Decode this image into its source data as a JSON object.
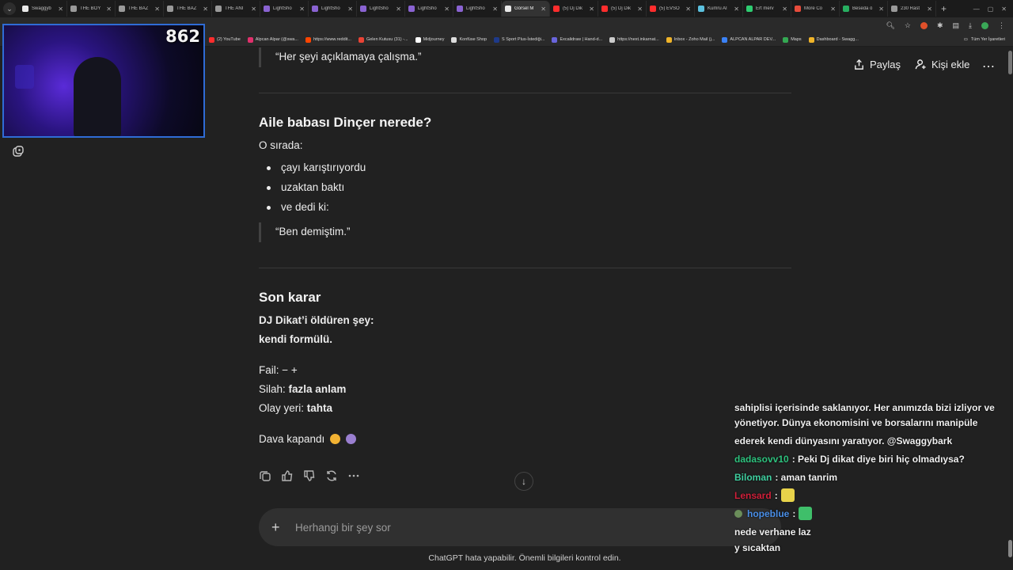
{
  "browser": {
    "tabs": [
      {
        "title": "Swaggyb",
        "color": "#e9e9e9",
        "active": false
      },
      {
        "title": "THE BOY",
        "color": "#9a9a9a",
        "active": false
      },
      {
        "title": "THE BAZ",
        "color": "#9a9a9a",
        "active": false
      },
      {
        "title": "THE BAZ",
        "color": "#9a9a9a",
        "active": false
      },
      {
        "title": "THE ANI",
        "color": "#9a9a9a",
        "active": false
      },
      {
        "title": "LightSho",
        "color": "#8a63d2",
        "active": false
      },
      {
        "title": "LightSho",
        "color": "#8a63d2",
        "active": false
      },
      {
        "title": "LightSho",
        "color": "#8a63d2",
        "active": false
      },
      {
        "title": "LightSho",
        "color": "#8a63d2",
        "active": false
      },
      {
        "title": "LightSho",
        "color": "#8a63d2",
        "active": false
      },
      {
        "title": "Görsel M",
        "color": "#e9e9e9",
        "active": true
      },
      {
        "title": "(5) Dj Dik",
        "color": "#ff2d2d",
        "active": false
      },
      {
        "title": "(5) Dj Dik",
        "color": "#ff2d2d",
        "active": false
      },
      {
        "title": "(5) EVSO",
        "color": "#ff2d2d",
        "active": false
      },
      {
        "title": "Kumru AI",
        "color": "#5bc0de",
        "active": false
      },
      {
        "title": "Ert merv",
        "color": "#2ecc71",
        "active": false
      },
      {
        "title": "More Co",
        "color": "#e74c3c",
        "active": false
      },
      {
        "title": "Beseda ö",
        "color": "#27ae60",
        "active": false
      },
      {
        "title": "230 Rast",
        "color": "#9a9a9a",
        "active": false
      }
    ],
    "bookmarks": [
      {
        "label": "(2) YouTube",
        "color": "#ff2d2d"
      },
      {
        "label": "Alpcan Alpar (@swa...",
        "color": "#e1306c"
      },
      {
        "label": "https://www.reddit...",
        "color": "#ff4500"
      },
      {
        "label": "Gelen Kutusu (31) -...",
        "color": "#ea4335"
      },
      {
        "label": "Midjourney",
        "color": "#ffffff"
      },
      {
        "label": "Konfüse Shop",
        "color": "#dddddd"
      },
      {
        "label": "S Sport Plus-İstediği...",
        "color": "#1e3a8a"
      },
      {
        "label": "Excalidraw | Hand-d...",
        "color": "#6965db"
      },
      {
        "label": "https://next.inkarnat...",
        "color": "#cccccc"
      },
      {
        "label": "Inbox - Zoho Mail (j...",
        "color": "#f0b429"
      },
      {
        "label": "ALPCAN ALPAR DEV...",
        "color": "#3b82f6"
      },
      {
        "label": "Maps",
        "color": "#34a853"
      },
      {
        "label": "Dashboard - Swagg...",
        "color": "#f0b429"
      }
    ],
    "all_bookmarks_label": "Tüm Yer İşaretleri"
  },
  "webcam": {
    "viewer_count": "862"
  },
  "header": {
    "share_label": "Paylaş",
    "add_person_label": "Kişi ekle",
    "more_label": "⋯"
  },
  "content": {
    "top_quote": "“Her şeyi açıklamaya çalışma.”",
    "section1": {
      "heading": "Aile babası Dinçer nerede?",
      "intro": "O sırada:",
      "bullets": [
        "çayı karıştırıyordu",
        "uzaktan baktı",
        "ve dedi ki:"
      ],
      "quote": "“Ben demiştim.”"
    },
    "section2": {
      "heading": "Son karar",
      "bold_line1": "DJ Dikat’i öldüren şey:",
      "bold_line2": "kendi formülü.",
      "fail_label": "Fail:",
      "fail_value": "− +",
      "weapon_label": "Silah:",
      "weapon_value": "fazla anlam",
      "scene_label": "Olay yeri:",
      "scene_value": "tahta",
      "closing": "Dava kapandı"
    }
  },
  "composer": {
    "placeholder": "Herhangi bir şey sor",
    "disclaimer": "ChatGPT hata yapabilir. Önemli bilgileri kontrol edin."
  },
  "stream_chat": {
    "cut_line": "sahiplisi içerisinde saklanıyor. Her anımızda bizi izliyor ve",
    "line2": "yönetiyor. Dünya ekonomisini ve borsalarını manipüle",
    "line3": "ederek kendi dünyasını yaratıyor. @Swaggybark",
    "messages": [
      {
        "user": "dadasovv10",
        "user_color": "#2ec27e",
        "text": ": Peki Dj dikat diye biri hiç olmadıysa?"
      },
      {
        "user": "Biloman",
        "user_color": "#3fd0a0",
        "text": ": aman tanrim"
      },
      {
        "user": "Lensard",
        "user_color": "#d0203a",
        "text": ":"
      },
      {
        "user": "hopeblue",
        "user_color": "#4a8fe8",
        "text": ":"
      }
    ],
    "tail1": "nede verhane laz",
    "tail2": "y sıcaktan"
  }
}
